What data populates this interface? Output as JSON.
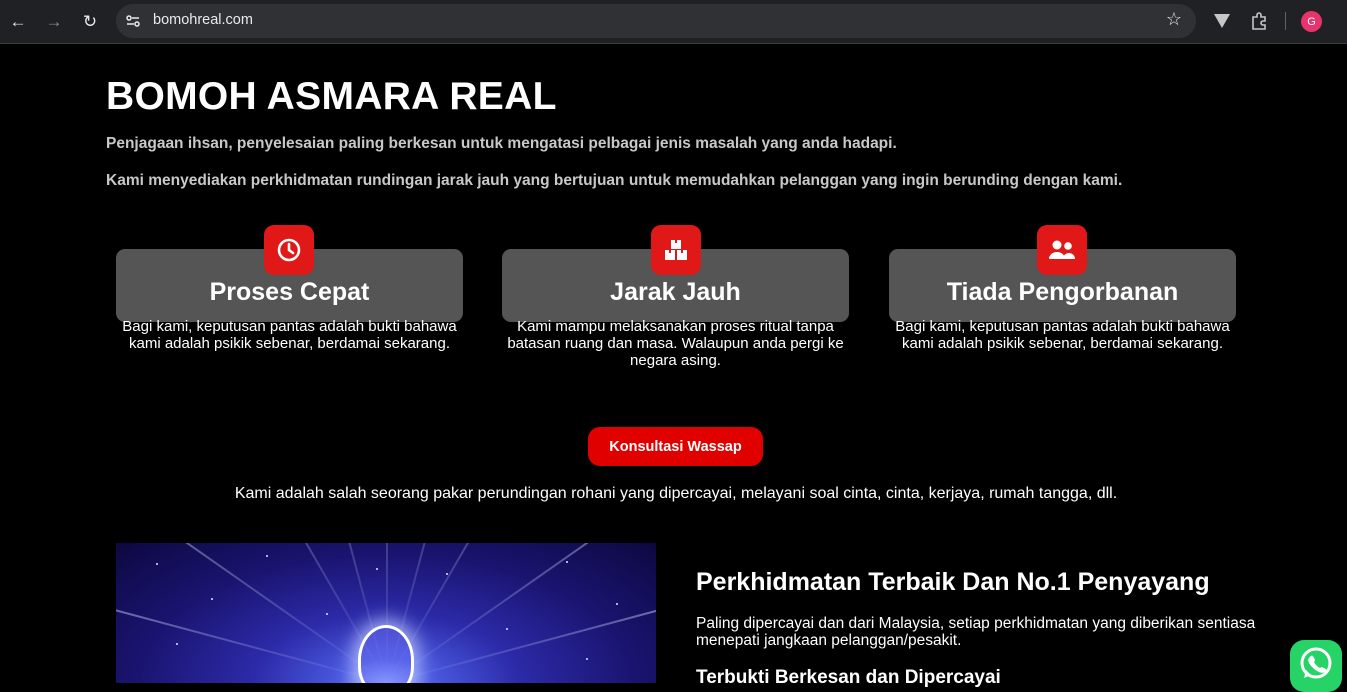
{
  "browser": {
    "url": "bomohreal.com",
    "profile_initial": "G"
  },
  "hero": {
    "title": "BOMOH ASMARA REAL",
    "paragraph1": "Penjagaan ihsan, penyelesaian paling berkesan untuk mengatasi pelbagai jenis masalah yang anda hadapi.",
    "paragraph2": "Kami menyediakan perkhidmatan rundingan jarak jauh yang bertujuan untuk memudahkan pelanggan yang ingin berunding dengan kami."
  },
  "features": [
    {
      "icon": "clock-icon",
      "title": "Proses Cepat",
      "text": "Bagi kami, keputusan pantas adalah bukti bahawa kami adalah psikik sebenar, berdamai sekarang."
    },
    {
      "icon": "boxes-icon",
      "title": "Jarak Jauh",
      "text": "Kami mampu melaksanakan proses ritual tanpa batasan ruang dan masa. Walaupun anda pergi ke negara asing."
    },
    {
      "icon": "users-icon",
      "title": "Tiada Pengorbanan",
      "text": "Bagi kami, keputusan pantas adalah bukti bahawa kami adalah psikik sebenar, berdamai sekarang."
    }
  ],
  "cta_label": "Konsultasi Wassap",
  "tagline": "Kami adalah salah seorang pakar perundingan rohani yang dipercayai, melayani soal cinta, cinta, kerjaya, rumah tangga, dll.",
  "section": {
    "title": "Perkhidmatan Terbaik Dan No.1 Penyayang",
    "paragraph": "Paling dipercayai dan dari Malaysia, setiap perkhidmatan yang diberikan sentiasa menepati jangkaan pelanggan/pesakit.",
    "subtitle": "Terbukti Berkesan dan Dipercayai"
  },
  "colors": {
    "accent": "#e01818",
    "card_bg": "#555555",
    "whatsapp": "#25d366"
  }
}
